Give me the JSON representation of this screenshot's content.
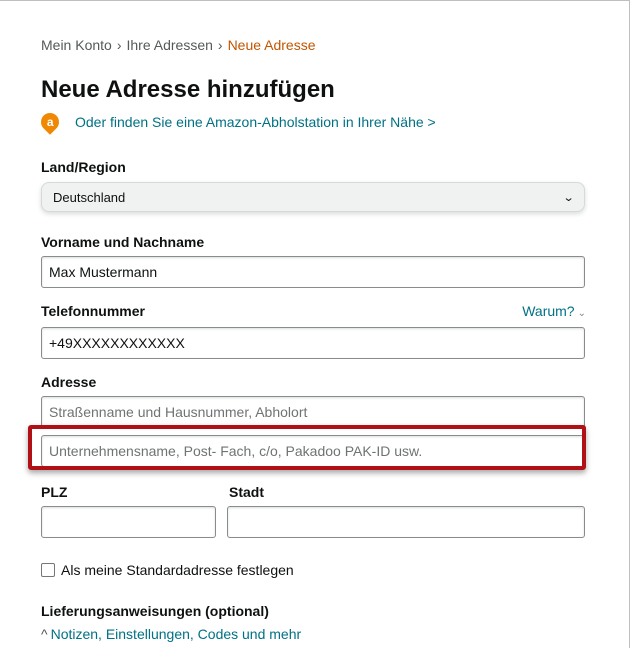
{
  "breadcrumb": {
    "items": [
      "Mein Konto",
      "Ihre Adressen",
      "Neue Adresse"
    ],
    "separator": "›"
  },
  "page_title": "Neue Adresse hinzufügen",
  "pickup": {
    "icon_letter": "a",
    "link_text": "Oder finden Sie eine Amazon-Abholstation in Ihrer Nähe >"
  },
  "country": {
    "label": "Land/Region",
    "selected": "Deutschland"
  },
  "fullname": {
    "label": "Vorname und Nachname",
    "value": "Max Mustermann"
  },
  "phone": {
    "label": "Telefonnummer",
    "value": "+49XXXXXXXXXXXX",
    "why_link": "Warum?"
  },
  "address": {
    "label": "Adresse",
    "line1_placeholder": "Straßenname und Hausnummer, Abholort",
    "line2_placeholder": "Unternehmensname, Post- Fach, c/o, Pakadoo PAK-ID usw."
  },
  "postal": {
    "label": "PLZ",
    "value": ""
  },
  "city": {
    "label": "Stadt",
    "value": ""
  },
  "default_checkbox": {
    "label": "Als meine Standardadresse festlegen",
    "checked": false
  },
  "delivery_instructions": {
    "label": "Lieferungsanweisungen (optional)",
    "expander_text": "Notizen, Einstellungen, Codes und mehr",
    "caret": "^"
  },
  "colors": {
    "link": "#007185",
    "breadcrumb_current": "#c45500",
    "highlight_border": "#b01116",
    "pin": "#f08804"
  }
}
